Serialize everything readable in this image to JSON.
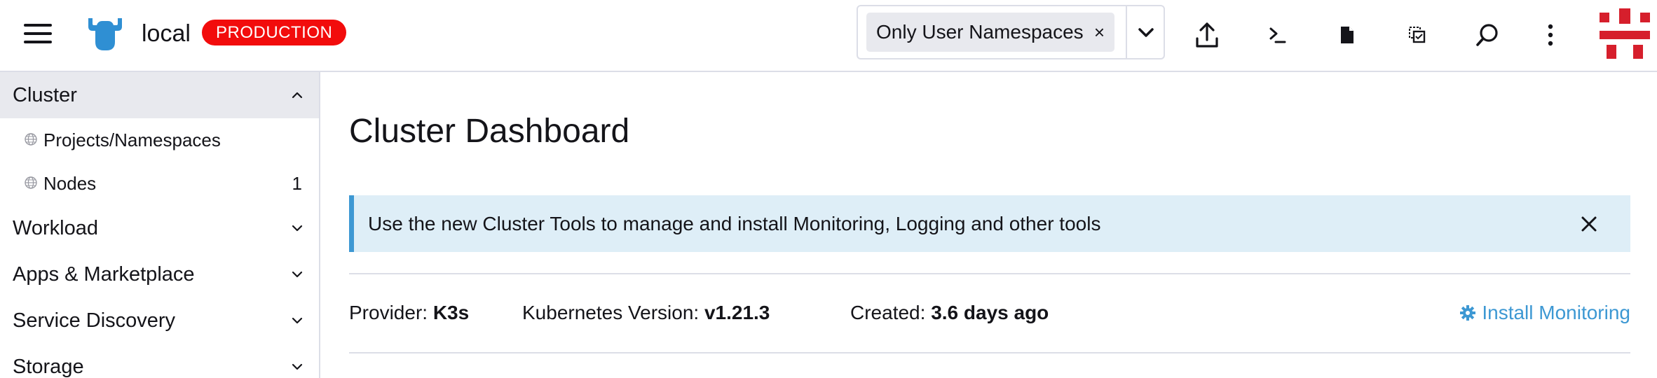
{
  "header": {
    "menu_icon": "hamburger-menu-icon",
    "logo_icon": "rancher-cow-logo",
    "cluster_name": "local",
    "env_badge": "PRODUCTION",
    "namespace_filter": {
      "selected": "Only User Namespaces",
      "remove_glyph": "×"
    },
    "actions": [
      {
        "name": "import-yaml",
        "icon": "upload-icon"
      },
      {
        "name": "kubectl-shell",
        "icon": "terminal-icon"
      },
      {
        "name": "download-kubeconfig",
        "icon": "file-icon"
      },
      {
        "name": "copy-kubeconfig",
        "icon": "copy-icon"
      },
      {
        "name": "search",
        "icon": "search-icon"
      },
      {
        "name": "more-actions",
        "icon": "kebab-icon"
      }
    ],
    "avatar_icon": "user-avatar"
  },
  "sidebar": {
    "groups": [
      {
        "label": "Cluster",
        "expanded": true,
        "items": [
          {
            "label": "Projects/Namespaces",
            "count": ""
          },
          {
            "label": "Nodes",
            "count": "1"
          }
        ]
      },
      {
        "label": "Workload",
        "expanded": false
      },
      {
        "label": "Apps & Marketplace",
        "expanded": false
      },
      {
        "label": "Service Discovery",
        "expanded": false
      },
      {
        "label": "Storage",
        "expanded": false
      }
    ]
  },
  "main": {
    "title": "Cluster Dashboard",
    "banner": {
      "text": "Use the new Cluster Tools to manage and install Monitoring, Logging and other tools",
      "close_glyph": "×"
    },
    "info": {
      "provider_label": "Provider:",
      "provider_value": "K3s",
      "k8s_label": "Kubernetes Version:",
      "k8s_value": "v1.21.3",
      "created_label": "Created:",
      "created_value": "3.6 days ago"
    },
    "install_monitoring": "Install Monitoring"
  },
  "colors": {
    "accent": "#3d98d3",
    "badge": "#f20c0c",
    "banner_bg": "#deeef7",
    "active_bg": "#e8e9ee",
    "border": "#dcdee7"
  }
}
